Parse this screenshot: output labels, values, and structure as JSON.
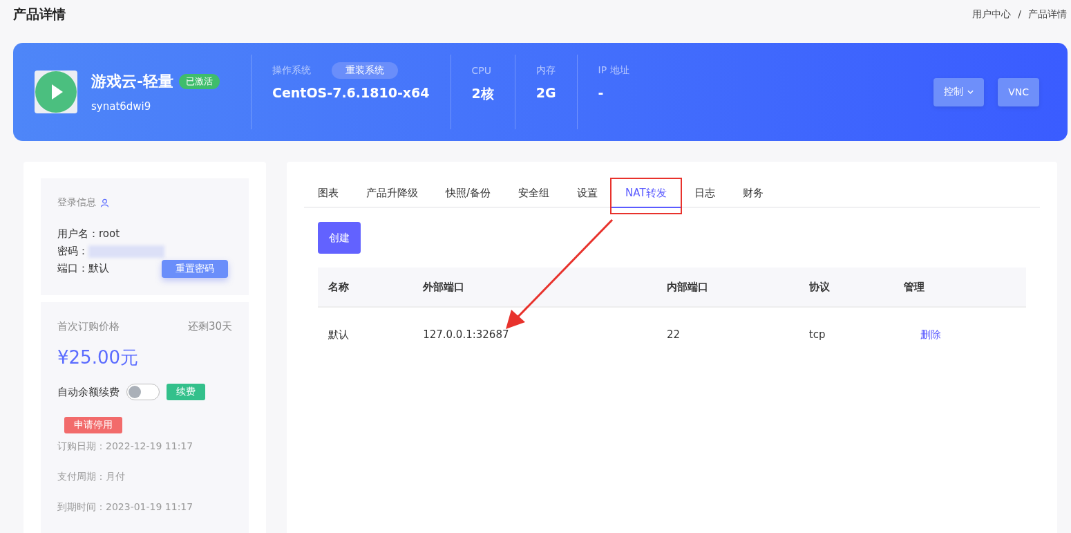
{
  "page": {
    "title": "产品详情",
    "breadcrumb": [
      "用户中心",
      "/",
      "产品详情"
    ]
  },
  "product": {
    "name": "游戏云-轻量",
    "status": "已激活",
    "active": true,
    "id": "synat6dwi9",
    "specs": [
      {
        "label": "操作系统",
        "value": "CentOS-7.6.1810-x64",
        "action": "重装系统"
      },
      {
        "label": "CPU",
        "value": "2核"
      },
      {
        "label": "内存",
        "value": "2G"
      },
      {
        "label": "IP 地址",
        "value": "-"
      }
    ],
    "buttons": [
      {
        "label": "控制",
        "kind": "dropdown"
      },
      {
        "label": "VNC",
        "kind": "plain"
      }
    ]
  },
  "login": {
    "title": "登录信息",
    "rows": [
      {
        "label": "用户名：",
        "value": "root",
        "kind": "text"
      },
      {
        "label": "密码：",
        "kind": "hidden"
      },
      {
        "label": "端口：",
        "value": "默认",
        "kind": "text"
      }
    ],
    "reset_button": "重置密码"
  },
  "billing": {
    "title": "首次订购价格",
    "remaining": "还剩30天",
    "price": "¥25.00元",
    "auto_renew": {
      "label": "自动余额续费",
      "on": false
    },
    "renew_button": "续费",
    "suspend_button": "申请停用",
    "details": [
      {
        "label": "订购日期：",
        "value": "2022-12-19 11:17"
      },
      {
        "label": "支付周期：",
        "value": "月付"
      },
      {
        "label": "到期时间：",
        "value": "2023-01-19 11:17"
      }
    ]
  },
  "tabs": [
    {
      "label": "图表",
      "selected": false
    },
    {
      "label": "产品升降级",
      "selected": false
    },
    {
      "label": "快照/备份",
      "selected": false
    },
    {
      "label": "安全组",
      "selected": false
    },
    {
      "label": "设置",
      "selected": false
    },
    {
      "label": "NAT转发",
      "selected": true
    },
    {
      "label": "日志",
      "selected": false
    },
    {
      "label": "财务",
      "selected": false
    }
  ],
  "create_button": "创建",
  "table": {
    "columns": [
      "名称",
      "外部端口",
      "内部端口",
      "协议",
      "管理"
    ],
    "rows": [
      {
        "cells": [
          "默认",
          "127.0.0.1:32687",
          "22",
          "tcp"
        ],
        "action": "删除"
      }
    ]
  }
}
